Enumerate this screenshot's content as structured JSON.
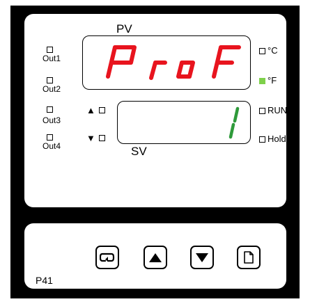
{
  "pv": {
    "label": "PV",
    "value": "Prof"
  },
  "sv": {
    "label": "SV",
    "value": "1"
  },
  "outputs": [
    {
      "label": "Out1",
      "lit": false
    },
    {
      "label": "Out2",
      "lit": false
    },
    {
      "label": "Out3",
      "lit": false
    },
    {
      "label": "Out4",
      "lit": false
    }
  ],
  "units": {
    "celsius": {
      "label": "°C",
      "lit": false
    },
    "fahrenheit": {
      "label": "°F",
      "lit": true
    }
  },
  "status": {
    "run": {
      "label": "RUN",
      "lit": false
    },
    "hold": {
      "label": "Hold",
      "lit": false
    }
  },
  "ramp": {
    "up_symbol": "▲",
    "down_symbol": "▼"
  },
  "buttons": [
    {
      "name": "cycle-button",
      "icon": "cycle-icon"
    },
    {
      "name": "up-button",
      "icon": "up-arrow-icon"
    },
    {
      "name": "down-button",
      "icon": "down-arrow-icon"
    },
    {
      "name": "page-button",
      "icon": "page-icon"
    }
  ],
  "model": "P41",
  "colors": {
    "segment": "#e8141e",
    "indicator_on": "#7ed04b",
    "bezel": "#000000"
  }
}
